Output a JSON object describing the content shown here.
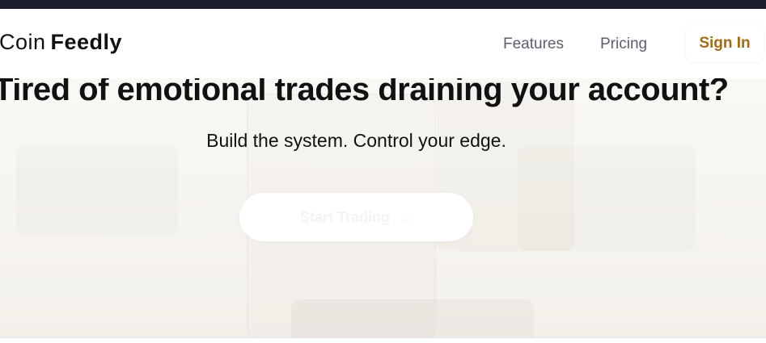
{
  "header": {
    "logo_light": "Coin",
    "logo_bold": "Feedly",
    "nav": {
      "features_label": "Features",
      "pricing_label": "Pricing"
    },
    "signin_label": "Sign In"
  },
  "hero": {
    "headline": "Tired of emotional trades draining your account?",
    "subheadline": "Build the system. Control your edge.",
    "cta_label": "Start Trading",
    "cta_icon": "arrow-right-icon"
  },
  "colors": {
    "top_strip": "#1c1d2b",
    "signin_text": "#a56a12",
    "nav_text": "#5a5f6b",
    "headline_text": "#111111"
  }
}
